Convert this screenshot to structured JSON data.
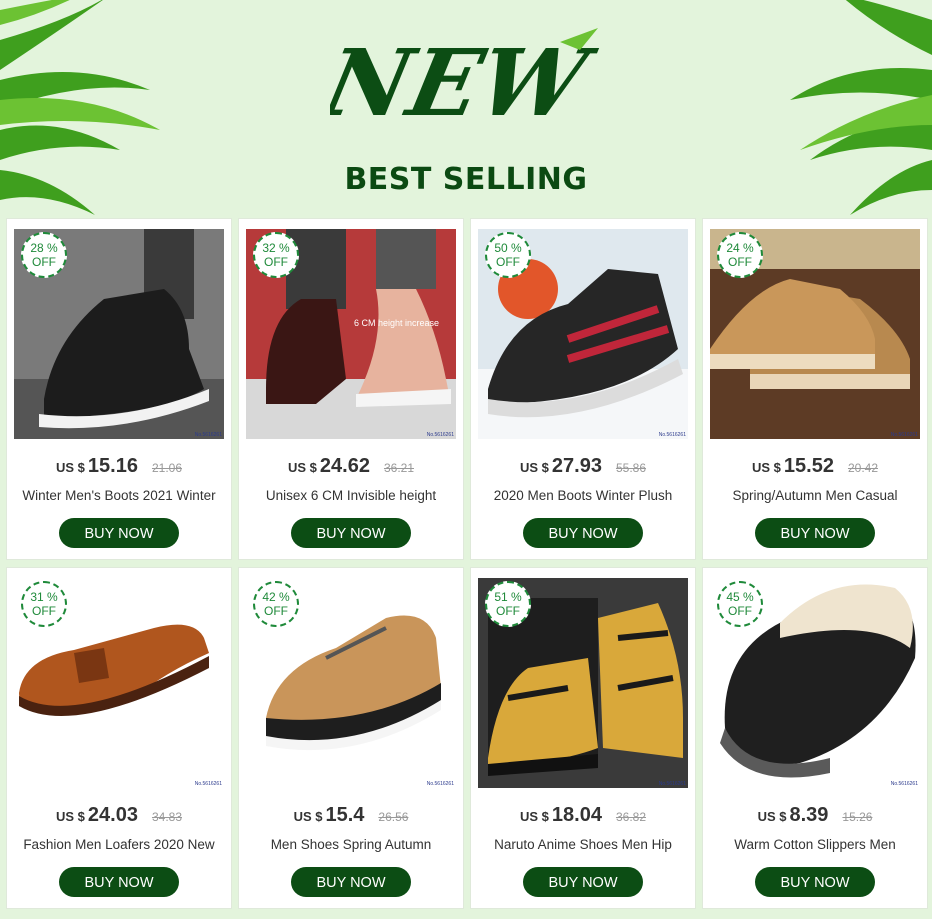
{
  "banner": {
    "logo_text": "NEW",
    "heading": "BEST SELLING"
  },
  "colors": {
    "background": "#e3f4dc",
    "button": "#0c4d14",
    "badge": "#1f8a3a",
    "heading": "#0b4a12"
  },
  "products": [
    {
      "discount_pct": "28 %",
      "discount_off": "OFF",
      "currency": "US $",
      "price": "15.16",
      "old_price": "21.06",
      "title": "Winter Men's Boots 2021 Winter",
      "button": "BUY NOW",
      "image": "black-leather-high-top-sneaker",
      "code": "No.5616261"
    },
    {
      "discount_pct": "32 %",
      "discount_off": "OFF",
      "currency": "US $",
      "price": "24.62",
      "old_price": "36.21",
      "title": "Unisex 6 CM Invisible height",
      "button": "BUY NOW",
      "image": "height-increase-boots",
      "image_text": "6 CM height increase",
      "code": "No.5616261"
    },
    {
      "discount_pct": "50 %",
      "discount_off": "OFF",
      "currency": "US $",
      "price": "27.93",
      "old_price": "55.86",
      "title": "2020 Men Boots Winter Plush",
      "button": "BUY NOW",
      "image": "winter-plush-snow-boot",
      "code": "No.5616261"
    },
    {
      "discount_pct": "24 %",
      "discount_off": "OFF",
      "currency": "US $",
      "price": "15.52",
      "old_price": "20.42",
      "title": "Spring/Autumn Men Casual",
      "button": "BUY NOW",
      "image": "tan-suede-casual-shoes",
      "code": "No.5616261"
    },
    {
      "discount_pct": "31 %",
      "discount_off": "OFF",
      "currency": "US $",
      "price": "24.03",
      "old_price": "34.83",
      "title": "Fashion Men Loafers 2020 New",
      "button": "BUY NOW",
      "image": "brown-monk-strap-loafer",
      "code": "No.5616261"
    },
    {
      "discount_pct": "42 %",
      "discount_off": "OFF",
      "currency": "US $",
      "price": "15.4",
      "old_price": "26.56",
      "title": "Men Shoes Spring Autumn",
      "button": "BUY NOW",
      "image": "tan-hiking-sneaker",
      "code": "No.5616261"
    },
    {
      "discount_pct": "51 %",
      "discount_off": "OFF",
      "currency": "US $",
      "price": "18.04",
      "old_price": "36.82",
      "title": "Naruto Anime Shoes Men Hip",
      "button": "BUY NOW",
      "image": "anime-print-high-top-sneaker",
      "code": "No.5616261"
    },
    {
      "discount_pct": "45 %",
      "discount_off": "OFF",
      "currency": "US $",
      "price": "8.39",
      "old_price": "15.26",
      "title": "Warm Cotton Slippers Men",
      "button": "BUY NOW",
      "image": "fleece-lined-slipper",
      "code": "No.5616261"
    }
  ]
}
